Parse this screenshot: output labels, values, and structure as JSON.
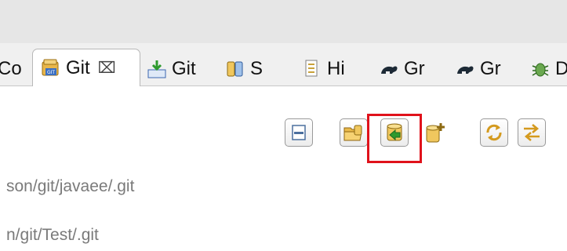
{
  "tabs": [
    {
      "label": "Co",
      "icon": "truncated-view-icon"
    },
    {
      "label": "Git",
      "icon": "git-repositories-icon",
      "active": true,
      "close": "⌧"
    },
    {
      "label": "Git",
      "icon": "git-staging-icon"
    },
    {
      "label": "S",
      "icon": "synchronize-icon"
    },
    {
      "label": "Hi",
      "icon": "history-icon"
    },
    {
      "label": "Gr",
      "icon": "gradle-tasks-icon"
    },
    {
      "label": "Gr",
      "icon": "gradle-executions-icon"
    },
    {
      "label": "D",
      "icon": "debug-bug-icon"
    }
  ],
  "toolbar": {
    "buttons": [
      "collapse-all-icon",
      "add-existing-repo-icon",
      "clone-repo-icon",
      "create-repo-icon",
      "refresh-icon",
      "link-with-selection-icon"
    ],
    "highlight_color": "#e0121b"
  },
  "repositories": [
    {
      "path": "son/git/javaee/.git"
    },
    {
      "path": "n/git/Test/.git"
    }
  ]
}
